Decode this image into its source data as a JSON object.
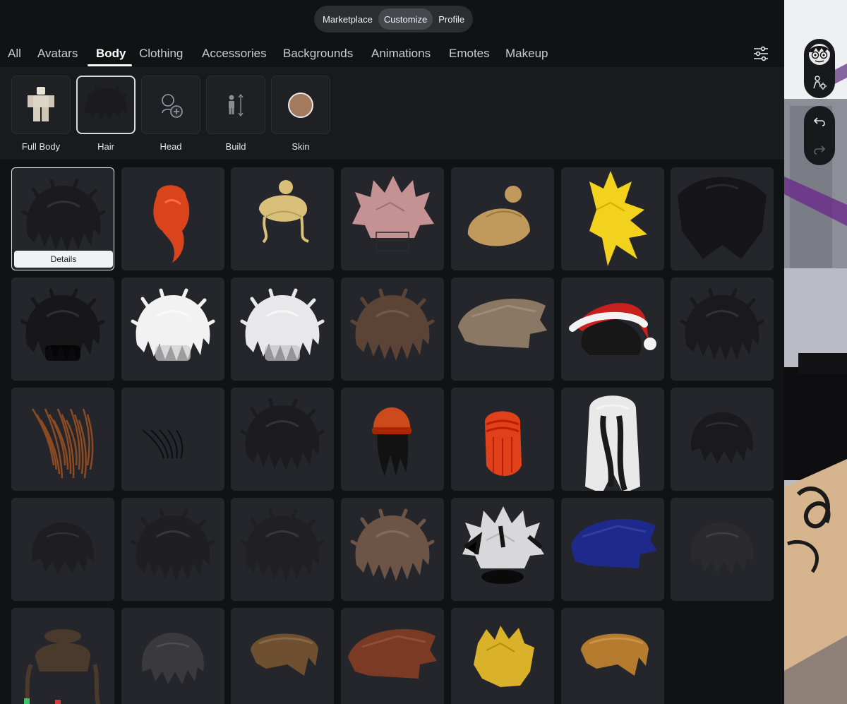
{
  "top_nav": {
    "items": [
      "Marketplace",
      "Customize",
      "Profile"
    ],
    "active": "Customize"
  },
  "tabs": [
    "All",
    "Avatars",
    "Body",
    "Clothing",
    "Accessories",
    "Backgrounds",
    "Animations",
    "Emotes",
    "Makeup"
  ],
  "active_tab": "Body",
  "subcategories": [
    {
      "label": "Full Body",
      "icon": "full-body-avatar-icon"
    },
    {
      "label": "Hair",
      "icon": "hair-thumbnail-icon"
    },
    {
      "label": "Head",
      "icon": "head-add-icon"
    },
    {
      "label": "Build",
      "icon": "build-height-icon"
    },
    {
      "label": "Skin",
      "icon": "skin-tone-icon"
    }
  ],
  "active_subcategory": "Hair",
  "details_label": "Details",
  "colors": {
    "panel_bg": "#111214",
    "tile_bg": "#25262c",
    "accent": "#ffffff",
    "skin_tone": "#a47a5e"
  },
  "hair_items": [
    {
      "color": "#1b1b1d",
      "style": "messy"
    },
    {
      "color": "#d9441c",
      "style": "ponytail"
    },
    {
      "color": "#d9c07a",
      "style": "bun-blonde"
    },
    {
      "color": "#c49292",
      "style": "spiky"
    },
    {
      "color": "#c09a5c",
      "style": "bun"
    },
    {
      "color": "#f3d21e",
      "style": "super-spiky"
    },
    {
      "color": "#161618",
      "style": "long"
    },
    {
      "color": "#17171a",
      "style": "fluffy"
    },
    {
      "color": "#f2f2f2",
      "style": "fluffy"
    },
    {
      "color": "#e8e8ea",
      "style": "fluffy"
    },
    {
      "color": "#5b4335",
      "style": "messy"
    },
    {
      "color": "#8a7865",
      "style": "swept"
    },
    {
      "color": "#c8211d",
      "style": "santa-hat"
    },
    {
      "color": "#1a1a1c",
      "style": "messy"
    },
    {
      "color": "#8a4a22",
      "style": "strands"
    },
    {
      "color": "#0d0d0d",
      "style": "strands-thin"
    },
    {
      "color": "#1c1c1e",
      "style": "messy"
    },
    {
      "color": "#cc4a1c",
      "style": "beanie"
    },
    {
      "color": "#e0411a",
      "style": "braids"
    },
    {
      "color": "#e9e9ea",
      "style": "long-wavy"
    },
    {
      "color": "#1a1a1c",
      "style": "small-messy"
    },
    {
      "color": "#1e1e20",
      "style": "small-messy"
    },
    {
      "color": "#1f1f22",
      "style": "messy"
    },
    {
      "color": "#202023",
      "style": "messy"
    },
    {
      "color": "#6c5446",
      "style": "messy"
    },
    {
      "color": "#d8d8da",
      "style": "spiky-bw"
    },
    {
      "color": "#1d2a8c",
      "style": "swept"
    },
    {
      "color": "#2b2b2e",
      "style": "small-messy"
    },
    {
      "color": "#4a3a2c",
      "style": "hat-braids"
    },
    {
      "color": "#3a3a3e",
      "style": "small-messy"
    },
    {
      "color": "#6e5030",
      "style": "slick"
    },
    {
      "color": "#7a3a24",
      "style": "swept"
    },
    {
      "color": "#d9b22a",
      "style": "spiky-gold"
    },
    {
      "color": "#b47a2e",
      "style": "slick"
    }
  ]
}
